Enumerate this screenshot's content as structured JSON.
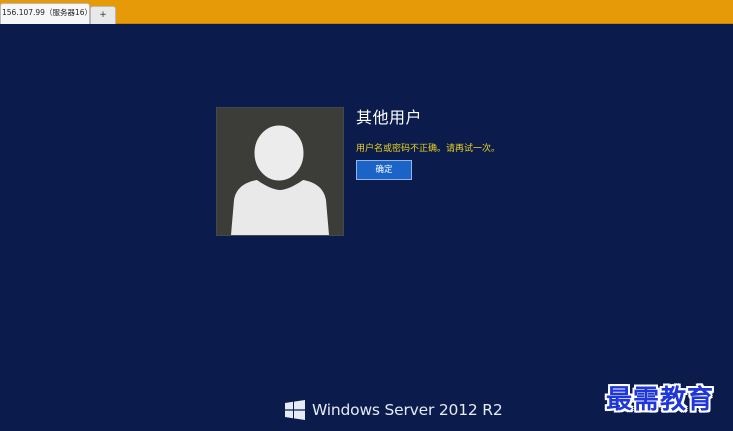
{
  "tabs": {
    "active_label": "156.107.99（服务器16）",
    "add_label": "+"
  },
  "login": {
    "user_name": "其他用户",
    "error_message": "用户名或密码不正确。请再试一次。",
    "ok_button": "确定"
  },
  "branding": {
    "os_name": "Windows Server 2012 R2",
    "logo_icon": "windows-logo-icon"
  },
  "watermark": {
    "text": "最需教育"
  },
  "colors": {
    "tab_strip": "#e79a08",
    "background": "#0b1c4c",
    "avatar_bg": "#3c3d39",
    "error_text": "#e9d21e",
    "button": "#1b64c5",
    "watermark": "#1f37d8"
  }
}
